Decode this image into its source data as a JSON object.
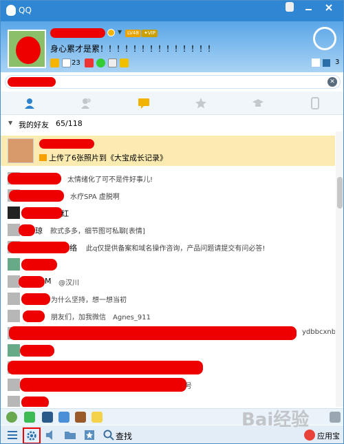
{
  "window": {
    "title": "QQ"
  },
  "profile": {
    "signature": "身心累才是累！！！！！！！！！！！！！！",
    "level_badge": "LV48",
    "vip_badge": "✦VIP",
    "mail_count": "23",
    "right_count": "3"
  },
  "tabs": [
    {
      "icon": "contact-icon"
    },
    {
      "icon": "group-icon"
    },
    {
      "icon": "chat-icon"
    },
    {
      "icon": "star-icon"
    },
    {
      "icon": "graduation-cap-icon"
    },
    {
      "icon": "phone-icon"
    }
  ],
  "group": {
    "name": "我的好友",
    "count": "65/118"
  },
  "selected_contact": {
    "update": "上传了6张照片到《大宝成长记录》"
  },
  "contacts": [
    {
      "name": "",
      "sig": "太情绪化了可不是件好事儿!"
    },
    {
      "name": "",
      "sig": "水疗SPA 虚脱啊"
    },
    {
      "name": "红",
      "sig": ""
    },
    {
      "name": "琼",
      "sig": "款式多多，细节图可私聊[表情]"
    },
    {
      "name": "络",
      "sig": "此q仅提供备案和域名操作咨询，产品问题请提交有问必答!"
    },
    {
      "name": "",
      "sig": ""
    },
    {
      "name": "M",
      "sig": "@汉川"
    },
    {
      "name": "",
      "sig": "为什么坚持，想一想当初"
    },
    {
      "name": "",
      "sig": "朋友们，加我微信　Agnes_911"
    },
    {
      "name": "",
      "sig": "ydbbcxnb"
    },
    {
      "name": "",
      "sig": ""
    },
    {
      "name": "",
      "sig": ""
    },
    {
      "name": "",
      "sig": "号"
    },
    {
      "name": "",
      "sig": ""
    }
  ],
  "bottom": {
    "find_label": "查找",
    "app_label": "应用宝"
  },
  "watermark": "Bai经验",
  "colors": {
    "titlebar": "#2f86d3",
    "redaction": "#e00000",
    "selected_row": "#fcebb1"
  }
}
